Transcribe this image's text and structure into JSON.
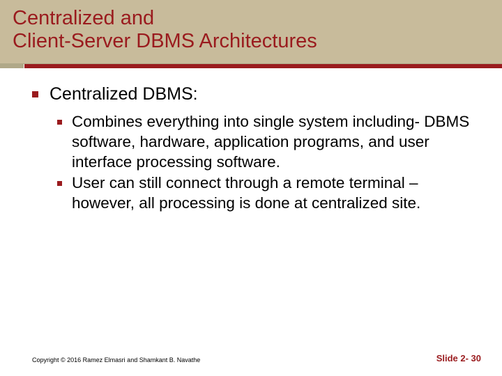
{
  "title_line1": "Centralized and",
  "title_line2": "Client-Server DBMS Architectures",
  "bullets": {
    "l1": "Centralized DBMS:",
    "l2a": "Combines everything into single system including- DBMS software, hardware, application programs, and user interface processing software.",
    "l2b": "User can still connect through a remote terminal – however, all processing is done at centralized site."
  },
  "footer": {
    "copyright": "Copyright © 2016 Ramez Elmasri and Shamkant B. Navathe",
    "slide": "Slide 2- 30"
  }
}
